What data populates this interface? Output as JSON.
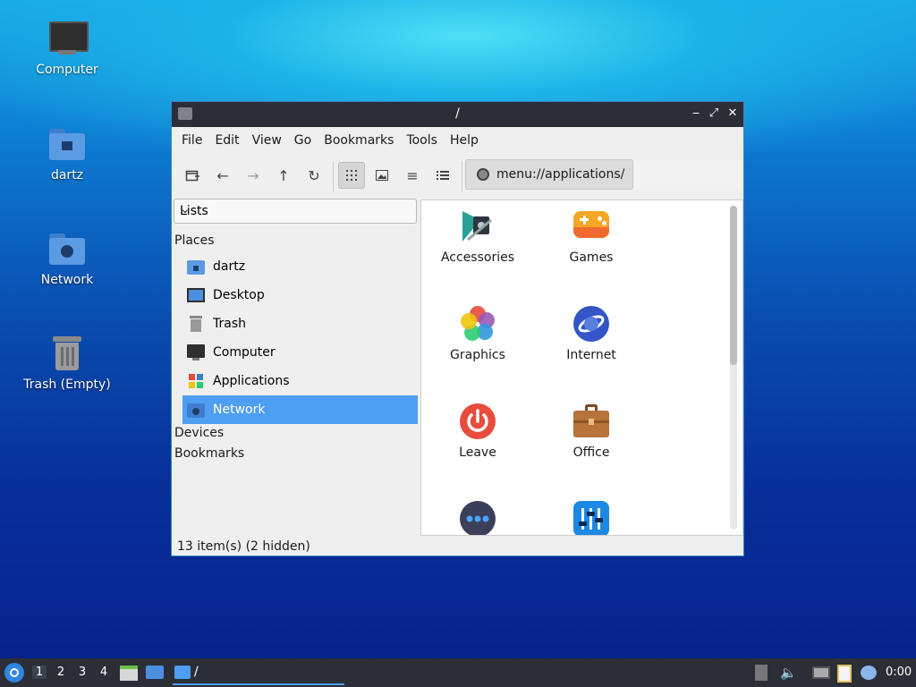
{
  "desktop": {
    "icons": [
      {
        "label": "Computer",
        "icon": "monitor-icon"
      },
      {
        "label": "dartz",
        "icon": "home-folder-icon"
      },
      {
        "label": "Network",
        "icon": "network-folder-icon"
      },
      {
        "label": "Trash (Empty)",
        "icon": "trash-icon"
      }
    ]
  },
  "window": {
    "title": "/",
    "controls": {
      "minimize": "‒",
      "maximize": "⤢",
      "close": "✕"
    },
    "menu": [
      "File",
      "Edit",
      "View",
      "Go",
      "Bookmarks",
      "Tools",
      "Help"
    ],
    "address": "menu://applications/",
    "side": {
      "mode": "Lists",
      "places_header": "Places",
      "places": [
        {
          "label": "dartz",
          "icon": "home-folder-icon"
        },
        {
          "label": "Desktop",
          "icon": "desktop-icon"
        },
        {
          "label": "Trash",
          "icon": "trash-icon"
        },
        {
          "label": "Computer",
          "icon": "monitor-icon"
        },
        {
          "label": "Applications",
          "icon": "applications-icon"
        },
        {
          "label": "Network",
          "icon": "network-folder-icon",
          "selected": true
        }
      ],
      "devices_header": "Devices",
      "bookmarks_header": "Bookmarks"
    },
    "apps": [
      {
        "label": "Accessories",
        "icon": "accessories-icon"
      },
      {
        "label": "Games",
        "icon": "gamepad-icon"
      },
      {
        "label": "Graphics",
        "icon": "graphics-icon"
      },
      {
        "label": "Internet",
        "icon": "internet-icon"
      },
      {
        "label": "Leave",
        "icon": "power-icon"
      },
      {
        "label": "Office",
        "icon": "briefcase-icon"
      },
      {
        "label": "",
        "icon": "more-icon"
      },
      {
        "label": "",
        "icon": "settings-sliders-icon"
      }
    ],
    "status": "13 item(s) (2 hidden)"
  },
  "taskbar": {
    "workspaces": [
      "1",
      "2",
      "3",
      "4"
    ],
    "current_workspace": "1",
    "task_label": "/",
    "clock": "0:00"
  },
  "colors": {
    "accent": "#4e9ff2",
    "titlebar": "#2b2e37"
  }
}
